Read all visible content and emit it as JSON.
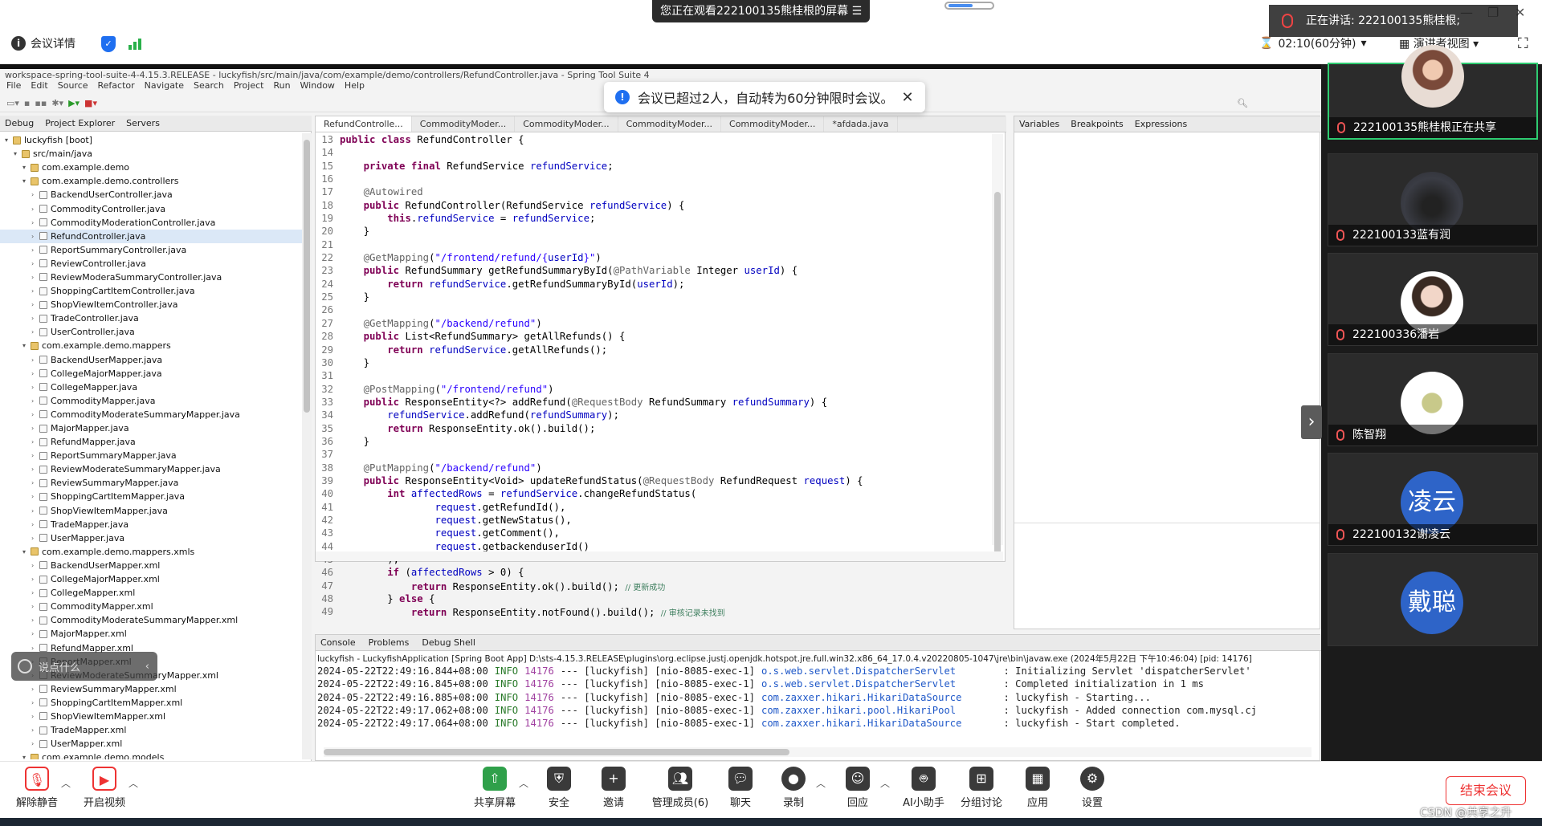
{
  "topbar": {
    "share_banner": "您正在观看222100135熊桂根的屏幕",
    "banner_menu_icon": "menu-icon",
    "meeting_info": "会议详情",
    "timer": "02:10(60分钟)",
    "presenter_view": "演讲者视图"
  },
  "eclipse": {
    "window_title": "workspace-spring-tool-suite-4-4.15.3.RELEASE - luckyfish/src/main/java/com/example/demo/controllers/RefundController.java - Spring Tool Suite 4",
    "menu": [
      "File",
      "Edit",
      "Source",
      "Refactor",
      "Navigate",
      "Search",
      "Project",
      "Run",
      "Window",
      "Help"
    ],
    "left_tabs": [
      "Debug",
      "Project Explorer",
      "Servers"
    ],
    "tree": [
      {
        "text": "luckyfish [boot]",
        "level": 0,
        "sel": false
      },
      {
        "text": "src/main/java",
        "level": 1,
        "sel": false
      },
      {
        "text": "com.example.demo",
        "level": 2,
        "sel": false
      },
      {
        "text": "com.example.demo.controllers",
        "level": 2,
        "sel": false
      },
      {
        "text": "BackendUserController.java",
        "level": 3,
        "sel": false
      },
      {
        "text": "CommodityController.java",
        "level": 3,
        "sel": false
      },
      {
        "text": "CommodityModerationController.java",
        "level": 3,
        "sel": false
      },
      {
        "text": "RefundController.java",
        "level": 3,
        "sel": true
      },
      {
        "text": "ReportSummaryController.java",
        "level": 3,
        "sel": false
      },
      {
        "text": "ReviewController.java",
        "level": 3,
        "sel": false
      },
      {
        "text": "ReviewModeraSummaryController.java",
        "level": 3,
        "sel": false
      },
      {
        "text": "ShoppingCartItemController.java",
        "level": 3,
        "sel": false
      },
      {
        "text": "ShopViewItemController.java",
        "level": 3,
        "sel": false
      },
      {
        "text": "TradeController.java",
        "level": 3,
        "sel": false
      },
      {
        "text": "UserController.java",
        "level": 3,
        "sel": false
      },
      {
        "text": "com.example.demo.mappers",
        "level": 2,
        "sel": false
      },
      {
        "text": "BackendUserMapper.java",
        "level": 3,
        "sel": false
      },
      {
        "text": "CollegeMajorMapper.java",
        "level": 3,
        "sel": false
      },
      {
        "text": "CollegeMapper.java",
        "level": 3,
        "sel": false
      },
      {
        "text": "CommodityMapper.java",
        "level": 3,
        "sel": false
      },
      {
        "text": "CommodityModerateSummaryMapper.java",
        "level": 3,
        "sel": false
      },
      {
        "text": "MajorMapper.java",
        "level": 3,
        "sel": false
      },
      {
        "text": "RefundMapper.java",
        "level": 3,
        "sel": false
      },
      {
        "text": "ReportSummaryMapper.java",
        "level": 3,
        "sel": false
      },
      {
        "text": "ReviewModerateSummaryMapper.java",
        "level": 3,
        "sel": false
      },
      {
        "text": "ReviewSummaryMapper.java",
        "level": 3,
        "sel": false
      },
      {
        "text": "ShoppingCartItemMapper.java",
        "level": 3,
        "sel": false
      },
      {
        "text": "ShopViewItemMapper.java",
        "level": 3,
        "sel": false
      },
      {
        "text": "TradeMapper.java",
        "level": 3,
        "sel": false
      },
      {
        "text": "UserMapper.java",
        "level": 3,
        "sel": false
      },
      {
        "text": "com.example.demo.mappers.xmls",
        "level": 2,
        "sel": false
      },
      {
        "text": "BackendUserMapper.xml",
        "level": 3,
        "sel": false
      },
      {
        "text": "CollegeMajorMapper.xml",
        "level": 3,
        "sel": false
      },
      {
        "text": "CollegeMapper.xml",
        "level": 3,
        "sel": false
      },
      {
        "text": "CommodityMapper.xml",
        "level": 3,
        "sel": false
      },
      {
        "text": "CommodityModerateSummaryMapper.xml",
        "level": 3,
        "sel": false
      },
      {
        "text": "MajorMapper.xml",
        "level": 3,
        "sel": false
      },
      {
        "text": "RefundMapper.xml",
        "level": 3,
        "sel": false
      },
      {
        "text": "ReportMapper.xml",
        "level": 3,
        "sel": false
      },
      {
        "text": "ReviewModerateSummaryMapper.xml",
        "level": 3,
        "sel": false
      },
      {
        "text": "ReviewSummaryMapper.xml",
        "level": 3,
        "sel": false
      },
      {
        "text": "ShoppingCartItemMapper.xml",
        "level": 3,
        "sel": false
      },
      {
        "text": "ShopViewItemMapper.xml",
        "level": 3,
        "sel": false
      },
      {
        "text": "TradeMapper.xml",
        "level": 3,
        "sel": false
      },
      {
        "text": "UserMapper.xml",
        "level": 3,
        "sel": false
      },
      {
        "text": "com.example.demo.models",
        "level": 2,
        "sel": false
      }
    ],
    "editor_tabs": [
      "RefundControlle...",
      "CommodityModer...",
      "CommodityModer...",
      "CommodityModer...",
      "CommodityModer...",
      "*afdada.java"
    ],
    "code": [
      {
        "n": "13",
        "t": "public class RefundController {"
      },
      {
        "n": "14",
        "t": ""
      },
      {
        "n": "15",
        "t": "    private final RefundService refundService;"
      },
      {
        "n": "16",
        "t": ""
      },
      {
        "n": "17",
        "t": "    @Autowired"
      },
      {
        "n": "18",
        "t": "    public RefundController(RefundService refundService) {"
      },
      {
        "n": "19",
        "t": "        this.refundService = refundService;"
      },
      {
        "n": "20",
        "t": "    }"
      },
      {
        "n": "21",
        "t": ""
      },
      {
        "n": "22",
        "t": "    @GetMapping(\"/frontend/refund/{userId}\")"
      },
      {
        "n": "23",
        "t": "    public RefundSummary getRefundSummaryById(@PathVariable Integer userId) {"
      },
      {
        "n": "24",
        "t": "        return refundService.getRefundSummaryById(userId);"
      },
      {
        "n": "25",
        "t": "    }"
      },
      {
        "n": "26",
        "t": ""
      },
      {
        "n": "27",
        "t": "    @GetMapping(\"/backend/refund\")"
      },
      {
        "n": "28",
        "t": "    public List<RefundSummary> getAllRefunds() {"
      },
      {
        "n": "29",
        "t": "        return refundService.getAllRefunds();"
      },
      {
        "n": "30",
        "t": "    }"
      },
      {
        "n": "31",
        "t": ""
      },
      {
        "n": "32",
        "t": "    @PostMapping(\"/frontend/refund\")"
      },
      {
        "n": "33",
        "t": "    public ResponseEntity<?> addRefund(@RequestBody RefundSummary refundSummary) {"
      },
      {
        "n": "34",
        "t": "        refundService.addRefund(refundSummary);"
      },
      {
        "n": "35",
        "t": "        return ResponseEntity.ok().build();"
      },
      {
        "n": "36",
        "t": "    }"
      },
      {
        "n": "37",
        "t": ""
      },
      {
        "n": "38",
        "t": "    @PutMapping(\"/backend/refund\")"
      },
      {
        "n": "39",
        "t": "    public ResponseEntity<Void> updateRefundStatus(@RequestBody RefundRequest request) {"
      },
      {
        "n": "40",
        "t": "        int affectedRows = refundService.changeRefundStatus("
      },
      {
        "n": "41",
        "t": "                request.getRefundId(),"
      },
      {
        "n": "42",
        "t": "                request.getNewStatus(),"
      },
      {
        "n": "43",
        "t": "                request.getComment(),"
      },
      {
        "n": "44",
        "t": "                request.getbackenduserId()"
      },
      {
        "n": "45",
        "t": "        );"
      },
      {
        "n": "46",
        "t": "        if (affectedRows > 0) {"
      },
      {
        "n": "47",
        "t": "            return ResponseEntity.ok().build(); // 更新成功"
      },
      {
        "n": "48",
        "t": "        } else {"
      },
      {
        "n": "49",
        "t": "            return ResponseEntity.notFound().build(); // 审核记录未找到"
      }
    ],
    "right_tabs": [
      "Variables",
      "Breakpoints",
      "Expressions"
    ],
    "console_tabs": [
      "Console",
      "Problems",
      "Debug Shell"
    ],
    "console_path": "luckyfish - LuckyfishApplication [Spring Boot App] D:\\sts-4.15.3.RELEASE\\plugins\\org.eclipse.justj.openjdk.hotspot.jre.full.win32.x86_64_17.0.4.v20220805-1047\\jre\\bin\\javaw.exe  (2024年5月22日 下午10:46:04) [pid: 14176]",
    "console_lines": [
      {
        "ts": "2024-05-22T22:49:16.844+08:00",
        "lvl": "INFO",
        "pid": "14176",
        "mid": "--- [luckyfish] [nio-8085-exec-1]",
        "src": "o.s.web.servlet.DispatcherServlet       ",
        "msg": ": Initializing Servlet 'dispatcherServlet'"
      },
      {
        "ts": "2024-05-22T22:49:16.845+08:00",
        "lvl": "INFO",
        "pid": "14176",
        "mid": "--- [luckyfish] [nio-8085-exec-1]",
        "src": "o.s.web.servlet.DispatcherServlet       ",
        "msg": ": Completed initialization in 1 ms"
      },
      {
        "ts": "2024-05-22T22:49:16.885+08:00",
        "lvl": "INFO",
        "pid": "14176",
        "mid": "--- [luckyfish] [nio-8085-exec-1]",
        "src": "com.zaxxer.hikari.HikariDataSource      ",
        "msg": ": luckyfish - Starting..."
      },
      {
        "ts": "2024-05-22T22:49:17.062+08:00",
        "lvl": "INFO",
        "pid": "14176",
        "mid": "--- [luckyfish] [nio-8085-exec-1]",
        "src": "com.zaxxer.hikari.pool.HikariPool       ",
        "msg": ": luckyfish - Added connection com.mysql.cj"
      },
      {
        "ts": "2024-05-22T22:49:17.064+08:00",
        "lvl": "INFO",
        "pid": "14176",
        "mid": "--- [luckyfish] [nio-8085-exec-1]",
        "src": "com.zaxxer.hikari.HikariDataSource      ",
        "msg": ": luckyfish - Start completed."
      }
    ]
  },
  "notification": "会议已超过2人，自动转为60分钟限时会议。",
  "speaking": "正在讲话:  222100135熊桂根;",
  "chat_overlay": "说点什么",
  "participants": [
    {
      "name": "222100135熊桂根正在共享",
      "avatar": "photo",
      "letter": ""
    },
    {
      "name": "222100133蓝有润",
      "avatar": "dark",
      "letter": ""
    },
    {
      "name": "222100336潘岩",
      "avatar": "photo-girl",
      "letter": ""
    },
    {
      "name": "陈智翔",
      "avatar": "logo",
      "letter": ""
    },
    {
      "name": "222100132谢凌云",
      "avatar": "letter",
      "letter": "凌云"
    },
    {
      "name": "",
      "avatar": "letter",
      "letter": "戴聪"
    }
  ],
  "bottombar": {
    "unmute": "解除静音",
    "start_video": "开启视频",
    "share_screen": "共享屏幕",
    "security": "安全",
    "invite": "邀请",
    "manage_members": "管理成员(6)",
    "chat": "聊天",
    "record": "录制",
    "reactions": "回应",
    "ai_assistant": "AI小助手",
    "breakout": "分组讨论",
    "apps": "应用",
    "settings": "设置",
    "end_meeting": "结束会议"
  },
  "watermark": "CSDN @共享之升",
  "colors": {
    "keyword": "#7f0055",
    "field": "#0000c0",
    "annotation": "#646464",
    "string": "#2a00ff",
    "comment": "#3f7f5f",
    "console_src": "#1f58c8",
    "accent": "#1f6ff0",
    "end": "#e33333"
  }
}
